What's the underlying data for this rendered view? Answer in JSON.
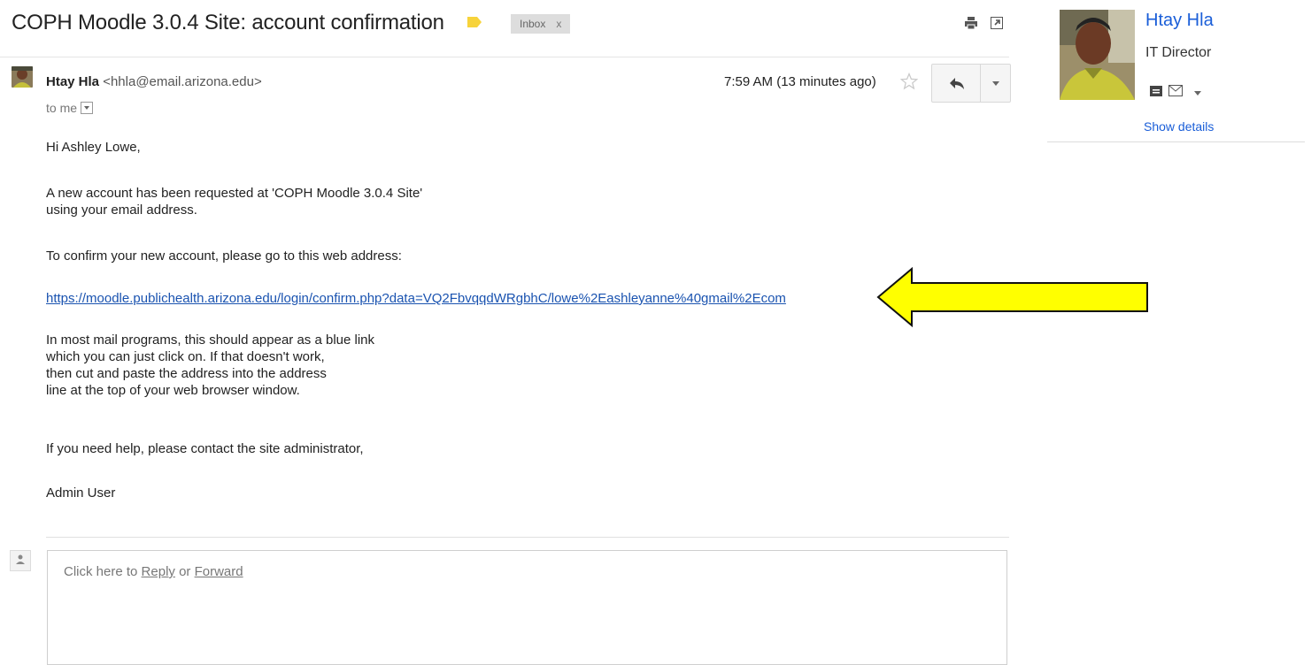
{
  "header": {
    "subject": "COPH Moodle 3.0.4 Site: account confirmation",
    "label_chip": "Inbox",
    "label_chip_close": "x",
    "icons": [
      "label-tag-icon",
      "print-icon",
      "new-window-icon"
    ],
    "label_color": "#f7d33b"
  },
  "message": {
    "sender_name": "Htay Hla",
    "sender_email": "<hhla@email.arizona.edu>",
    "recipient": "to me",
    "time": "7:59 AM (13 minutes ago)",
    "body": {
      "greeting": "Hi Ashley Lowe,",
      "para1_line1": "A new account has been requested at 'COPH Moodle 3.0.4 Site'",
      "para1_line2": "using your email address.",
      "para2": "To confirm your new account, please go to this web address:",
      "link": "https://moodle.publichealth.arizona.edu/login/confirm.php?data=VQ2FbvqqdWRgbhC/lowe%2Eashleyanne%40gmail%2Ecom",
      "para3_line1": "In most mail programs, this should appear as a blue link",
      "para3_line2": "which you can just click on. If that doesn't work,",
      "para3_line3": "then cut and paste the address into the address",
      "para3_line4": "line at the top of your web browser window.",
      "para4": "If you need help, please contact the site administrator,",
      "signature": "Admin User"
    },
    "annotation_arrow_color": "#ffff00"
  },
  "reply_box": {
    "prompt_prefix": "Click here to",
    "reply_link": "Reply",
    "or_text": "or",
    "forward_link": "Forward"
  },
  "contact_card": {
    "name": "Htay Hla",
    "role": "IT Director",
    "show_details": "Show details"
  },
  "colors": {
    "link": "#1a53b0",
    "contact_link": "#1a5ed8",
    "arrow_fill": "#ffff00"
  }
}
